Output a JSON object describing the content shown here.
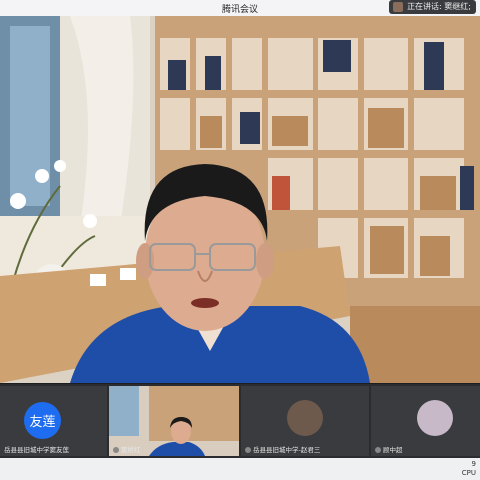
{
  "app": {
    "title": "腾讯会议"
  },
  "speaking": {
    "label": "正在讲话: 窦继红;"
  },
  "participants": [
    {
      "avatar_text": "友莲",
      "name": "岳县县旧城中学窦友莲"
    },
    {
      "name": "窦继红"
    },
    {
      "name": "岳县县旧城中学-赵君三"
    },
    {
      "name": "顾中超"
    }
  ],
  "status": {
    "line1": "9",
    "line2": "CPU"
  },
  "colors": {
    "accent": "#1e6cf0",
    "strip_bg": "#2b2c2f",
    "shirt": "#1f4ea8"
  }
}
